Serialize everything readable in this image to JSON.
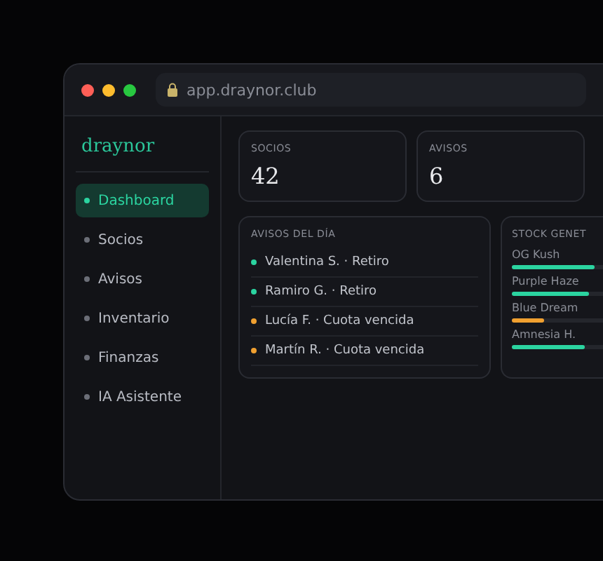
{
  "browser": {
    "url": "app.draynor.club"
  },
  "sidebar": {
    "logo": "draynor",
    "items": [
      {
        "label": "Dashboard",
        "selected": true
      },
      {
        "label": "Socios",
        "selected": false
      },
      {
        "label": "Avisos",
        "selected": false
      },
      {
        "label": "Inventario",
        "selected": false
      },
      {
        "label": "Finanzas",
        "selected": false
      },
      {
        "label": "IA Asistente",
        "selected": false
      }
    ]
  },
  "stats": [
    {
      "label": "SOCIOS",
      "value": "42"
    },
    {
      "label": "AVISOS",
      "value": "6"
    }
  ],
  "alerts": {
    "title": "AVISOS DEL DÍA",
    "items": [
      {
        "text": "Valentina S. · Retiro",
        "color": "#2bd4a0"
      },
      {
        "text": "Ramiro G. · Retiro",
        "color": "#2bd4a0"
      },
      {
        "text": "Lucía F. · Cuota vencida",
        "color": "#f0a030"
      },
      {
        "text": "Martín R. · Cuota vencida",
        "color": "#f0a030"
      }
    ]
  },
  "stock": {
    "title": "STOCK GENET",
    "items": [
      {
        "name": "OG Kush",
        "level": 0.9,
        "color": "#2bd4a0"
      },
      {
        "name": "Purple Haze",
        "level": 0.85,
        "color": "#2bd4a0"
      },
      {
        "name": "Blue Dream",
        "level": 0.35,
        "color": "#f0a030"
      },
      {
        "name": "Amnesia H.",
        "level": 0.8,
        "color": "#2bd4a0"
      }
    ]
  }
}
